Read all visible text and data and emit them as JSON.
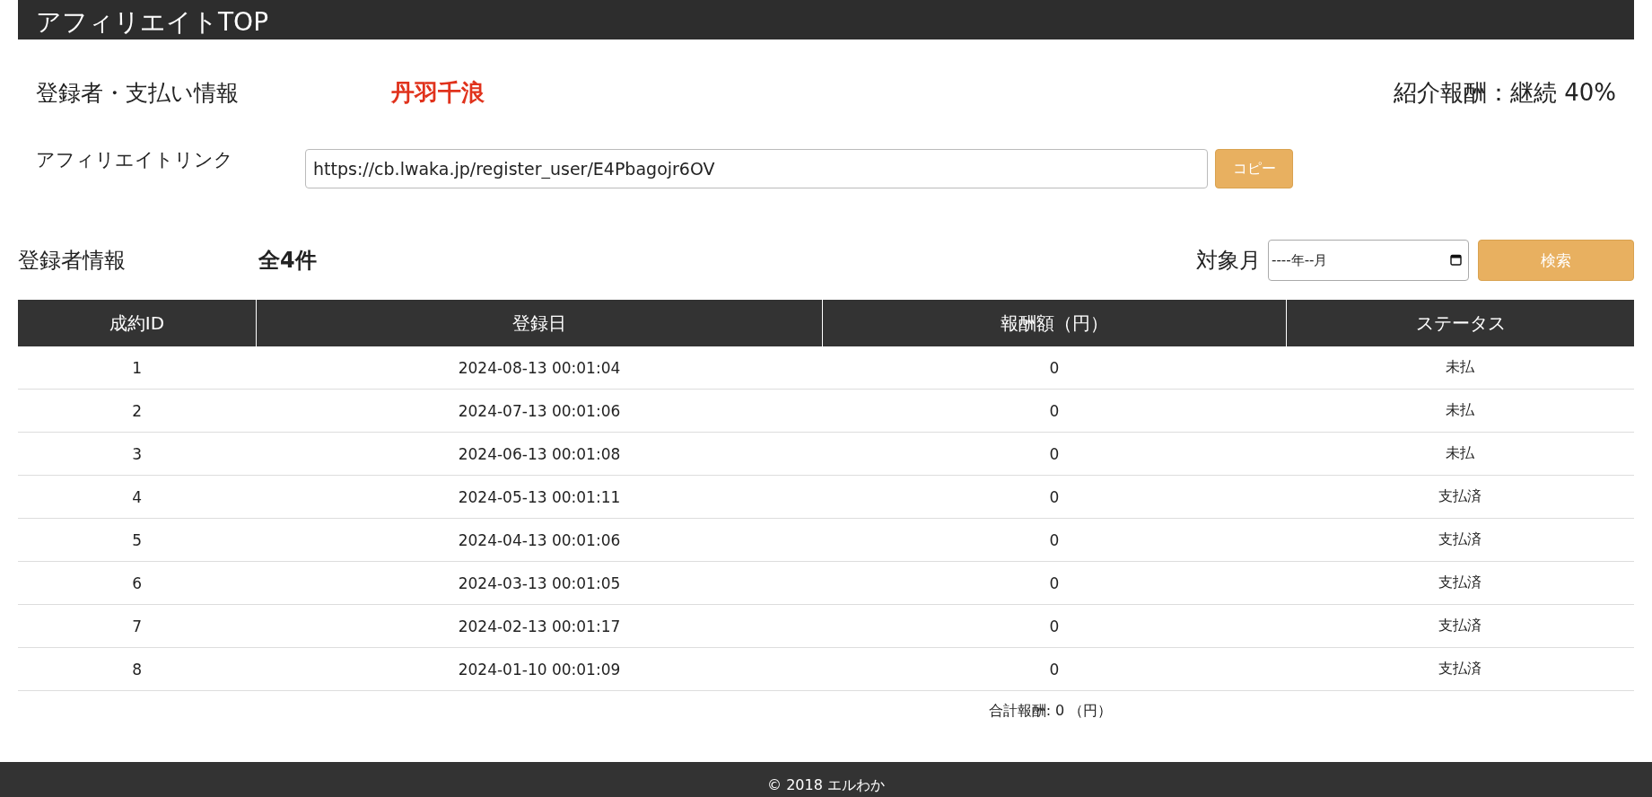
{
  "page_title": "アフィリエイトTOP",
  "registrant": {
    "label": "登録者・支払い情報",
    "name": "丹羽千浪",
    "commission": "紹介報酬：継続 40%"
  },
  "affiliate_link": {
    "label": "アフィリエイトリンク",
    "value": "https://cb.lwaka.jp/register_user/E4Pbagojr6OV",
    "copy_button": "コピー"
  },
  "registrants": {
    "label": "登録者情報",
    "count": "全4件",
    "month_label": "対象月",
    "month_placeholder": "----年--月",
    "search_button": "検索"
  },
  "table": {
    "columns": [
      "成約ID",
      "登録日",
      "報酬額（円）",
      "ステータス"
    ],
    "rows": [
      [
        "1",
        "2024-08-13 00:01:04",
        "0",
        "未払"
      ],
      [
        "2",
        "2024-07-13 00:01:06",
        "0",
        "未払"
      ],
      [
        "3",
        "2024-06-13 00:01:08",
        "0",
        "未払"
      ],
      [
        "4",
        "2024-05-13 00:01:11",
        "0",
        "支払済"
      ],
      [
        "5",
        "2024-04-13 00:01:06",
        "0",
        "支払済"
      ],
      [
        "6",
        "2024-03-13 00:01:05",
        "0",
        "支払済"
      ],
      [
        "7",
        "2024-02-13 00:01:17",
        "0",
        "支払済"
      ],
      [
        "8",
        "2024-01-10 00:01:09",
        "0",
        "支払済"
      ]
    ],
    "total": "合計報酬: 0 （円）"
  },
  "footer": "© 2018 エルわか"
}
